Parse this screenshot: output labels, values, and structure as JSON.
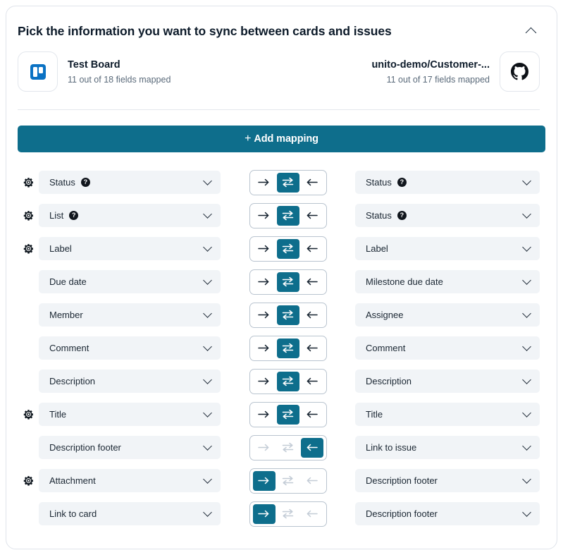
{
  "header": {
    "title": "Pick the information you want to sync between cards and issues",
    "collapse_icon": "chevron-up-icon"
  },
  "summary": {
    "left": {
      "icon": "trello-icon",
      "name": "Test Board",
      "fields_mapped": "11 out of 18 fields mapped"
    },
    "right": {
      "icon": "github-icon",
      "name": "unito-demo/Customer-...",
      "fields_mapped": "11 out of 17 fields mapped"
    }
  },
  "toolbar": {
    "add_mapping_label": "Add mapping",
    "add_mapping_plus": "+"
  },
  "icons": {
    "gear": "gear-icon",
    "help": "?",
    "chevron_down": "chevron-down-icon",
    "arrow_right": "arrow-right-icon",
    "arrow_left": "arrow-left-icon",
    "two_way": "two-way-sync-icon"
  },
  "colors": {
    "accent": "#0e6e8c",
    "field_bg": "#f1f4f7",
    "card_border": "#dfe3ea",
    "text": "#0d1b2a",
    "muted": "#5a6a7a",
    "trello_blue": "#0a72c4",
    "disabled": "#c3ccd6"
  },
  "mappings": [
    {
      "gear": true,
      "left": {
        "label": "Status",
        "help": true
      },
      "right": {
        "label": "Status",
        "help": true
      },
      "direction": "both",
      "disabled": false
    },
    {
      "gear": true,
      "left": {
        "label": "List",
        "help": true
      },
      "right": {
        "label": "Status",
        "help": true
      },
      "direction": "both",
      "disabled": false
    },
    {
      "gear": true,
      "left": {
        "label": "Label",
        "help": false
      },
      "right": {
        "label": "Label",
        "help": false
      },
      "direction": "both",
      "disabled": false
    },
    {
      "gear": false,
      "left": {
        "label": "Due date",
        "help": false
      },
      "right": {
        "label": "Milestone due date",
        "help": false
      },
      "direction": "both",
      "disabled": false
    },
    {
      "gear": false,
      "left": {
        "label": "Member",
        "help": false
      },
      "right": {
        "label": "Assignee",
        "help": false
      },
      "direction": "both",
      "disabled": false
    },
    {
      "gear": false,
      "left": {
        "label": "Comment",
        "help": false
      },
      "right": {
        "label": "Comment",
        "help": false
      },
      "direction": "both",
      "disabled": false
    },
    {
      "gear": false,
      "left": {
        "label": "Description",
        "help": false
      },
      "right": {
        "label": "Description",
        "help": false
      },
      "direction": "both",
      "disabled": false
    },
    {
      "gear": true,
      "left": {
        "label": "Title",
        "help": false
      },
      "right": {
        "label": "Title",
        "help": false
      },
      "direction": "both",
      "disabled": false
    },
    {
      "gear": false,
      "left": {
        "label": "Description footer",
        "help": false
      },
      "right": {
        "label": "Link to issue",
        "help": false
      },
      "direction": "left",
      "disabled": true
    },
    {
      "gear": true,
      "left": {
        "label": "Attachment",
        "help": false
      },
      "right": {
        "label": "Description footer",
        "help": false
      },
      "direction": "right",
      "disabled": true
    },
    {
      "gear": false,
      "left": {
        "label": "Link to card",
        "help": false
      },
      "right": {
        "label": "Description footer",
        "help": false
      },
      "direction": "right",
      "disabled": true
    }
  ]
}
